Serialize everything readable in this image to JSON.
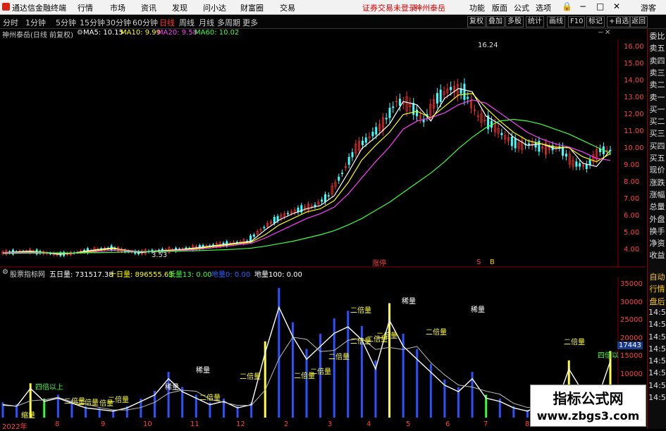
{
  "app": {
    "title": "通达信金融终端",
    "menu": [
      "行情",
      "市场",
      "资讯",
      "发现",
      "问小达",
      "财富圈",
      "交易"
    ],
    "alert": "证券交易未登录",
    "stock_name_red": "神州泰岳",
    "right_menu": [
      "功能",
      "版面",
      "公式",
      "选项"
    ],
    "window_controls": [
      "🔒",
      "−",
      "□",
      "✕"
    ],
    "guest": "游客"
  },
  "periods": [
    "分时",
    "1分钟",
    "5分钟",
    "15分钟",
    "30分钟",
    "60分钟",
    "日线",
    "周线",
    "月线",
    "多周期",
    "更多"
  ],
  "active_period": "日线",
  "toolbar_right": [
    "复权",
    "叠加",
    "多股",
    "统计",
    "画线",
    "F10",
    "标记",
    "+自选",
    "返回"
  ],
  "info": {
    "name": "神州泰岳(日线 前复权)",
    "ma5": "MA5: 10.15",
    "ma10": "MA10: 9.99",
    "ma20": "MA20: 9.58",
    "ma60": "MA60: 10.02"
  },
  "side_panel": [
    "委比",
    "卖五",
    "卖四",
    "卖三",
    "卖二",
    "卖一",
    "买一",
    "买二",
    "买三",
    "买四",
    "买五",
    "现价",
    "涨跌",
    "涨幅",
    "总量",
    "外盘",
    "换手",
    "净资",
    "收益"
  ],
  "side_panel_lower": [
    "自动",
    "行情",
    "盘后",
    "14:5",
    "14:5",
    "14:5",
    "14:5",
    "14:5",
    "14:5",
    "14:5",
    "14:5"
  ],
  "price_axis": [
    "16.00",
    "15.00",
    "14.00",
    "13.00",
    "12.00",
    "11.00",
    "10.00",
    "9.00",
    "8.00",
    "7.00",
    "6.00",
    "5.00",
    "4.00"
  ],
  "price_markers": {
    "high": "16.24",
    "low": "3.53"
  },
  "main_tags": [
    {
      "text": "涨停"
    },
    {
      "text": "S"
    },
    {
      "text": "B"
    }
  ],
  "volume_header": {
    "name": "股票指标网",
    "v5": "五日量: 731517.38",
    "v10": "十日量: 896555.63",
    "low": "低量13: 0.00",
    "mid": "地量0: 0.00",
    "floor": "地量100: 0.00"
  },
  "volume_axis": [
    "35000",
    "30000",
    "25000",
    "20000",
    "15000",
    "10000",
    "5000"
  ],
  "volume_current": "17443",
  "volume_labels": [
    "四倍以上",
    "二倍量",
    "二倍量",
    "缩量",
    "倍量",
    "二倍量",
    "二倍量",
    "二倍量",
    "二倍量",
    "二倍量",
    "二倍量",
    "二倍量",
    "二倍量",
    "二倍量",
    "二倍量",
    "二倍量",
    "二倍量",
    "四倍以"
  ],
  "volume_labels_white": [
    "稀量",
    "稀量",
    "稀量",
    "稀量"
  ],
  "x_axis": [
    "2022年",
    "8",
    "9",
    "10",
    "11",
    "12",
    "2",
    "3",
    "4",
    "5",
    "6",
    "7",
    "8"
  ],
  "watermark": {
    "line1": "指标公式网",
    "line2": "www.zbgs3.com"
  },
  "colors": {
    "ma5": "#ffffff",
    "ma10": "#ffff00",
    "ma20": "#ff40ff",
    "ma60": "#40ff40",
    "up": "#ff3030",
    "down": "#40ffff",
    "axis": "#ff4040"
  },
  "chart_data": {
    "type": "line",
    "title": "神州泰岳(日线 前复权)",
    "ylim": [
      3.5,
      16.5
    ],
    "series": [
      {
        "name": "MA5",
        "values": [
          3.9,
          3.95,
          4.0,
          3.9,
          3.8,
          3.85,
          4.0,
          4.1,
          4.2,
          4.0,
          3.9,
          4.0,
          4.05,
          4.1,
          4.2,
          4.3,
          4.4,
          4.5,
          4.6,
          5.3,
          5.9,
          6.3,
          6.6,
          6.8,
          7.4,
          8.8,
          10.3,
          11.0,
          11.8,
          13.2,
          13.0,
          12.0,
          13.4,
          14.0,
          13.8,
          12.3,
          11.8,
          11.0,
          10.5,
          10.6,
          10.3,
          10.4,
          9.4,
          9.2,
          10.2
        ]
      },
      {
        "name": "MA10",
        "values": [
          3.9,
          3.92,
          3.95,
          3.92,
          3.85,
          3.85,
          3.95,
          4.05,
          4.15,
          4.05,
          3.95,
          3.98,
          4.02,
          4.08,
          4.15,
          4.25,
          4.35,
          4.45,
          4.55,
          5.0,
          5.6,
          6.0,
          6.4,
          6.6,
          7.1,
          8.2,
          9.6,
          10.5,
          11.3,
          12.4,
          12.6,
          12.2,
          12.9,
          13.6,
          13.7,
          12.8,
          12.0,
          11.3,
          10.8,
          10.6,
          10.4,
          10.35,
          9.8,
          9.5,
          9.99
        ]
      },
      {
        "name": "MA20",
        "values": [
          3.9,
          3.9,
          3.92,
          3.9,
          3.88,
          3.86,
          3.9,
          3.98,
          4.05,
          4.02,
          3.98,
          3.98,
          4.0,
          4.05,
          4.1,
          4.18,
          4.28,
          4.38,
          4.48,
          4.8,
          5.2,
          5.6,
          6.0,
          6.3,
          6.7,
          7.5,
          8.5,
          9.5,
          10.4,
          11.5,
          12.0,
          12.2,
          12.5,
          13.0,
          13.3,
          13.1,
          12.5,
          11.9,
          11.3,
          10.9,
          10.6,
          10.4,
          10.1,
          9.7,
          9.58
        ]
      },
      {
        "name": "MA60",
        "values": [
          3.85,
          3.86,
          3.87,
          3.88,
          3.88,
          3.88,
          3.89,
          3.9,
          3.92,
          3.94,
          3.95,
          3.96,
          3.98,
          4.0,
          4.02,
          4.05,
          4.08,
          4.12,
          4.18,
          4.3,
          4.45,
          4.6,
          4.8,
          5.0,
          5.25,
          5.6,
          6.0,
          6.5,
          7.0,
          7.6,
          8.2,
          8.8,
          9.5,
          10.3,
          11.0,
          11.6,
          12.0,
          12.1,
          12.0,
          11.8,
          11.5,
          11.2,
          10.8,
          10.4,
          10.02
        ]
      }
    ],
    "volume": [
      4000,
      3500,
      9000,
      5000,
      6000,
      4500,
      3000,
      2500,
      2000,
      3000,
      5000,
      7000,
      12000,
      8000,
      6000,
      4000,
      5000,
      3000,
      4000,
      20000,
      34000,
      25000,
      18000,
      22000,
      26000,
      28000,
      24000,
      15000,
      30000,
      22000,
      18000,
      14000,
      10000,
      8000,
      12000,
      6000,
      5000,
      3000,
      2000,
      4000,
      3000,
      15000,
      8000,
      5000,
      17443
    ]
  }
}
